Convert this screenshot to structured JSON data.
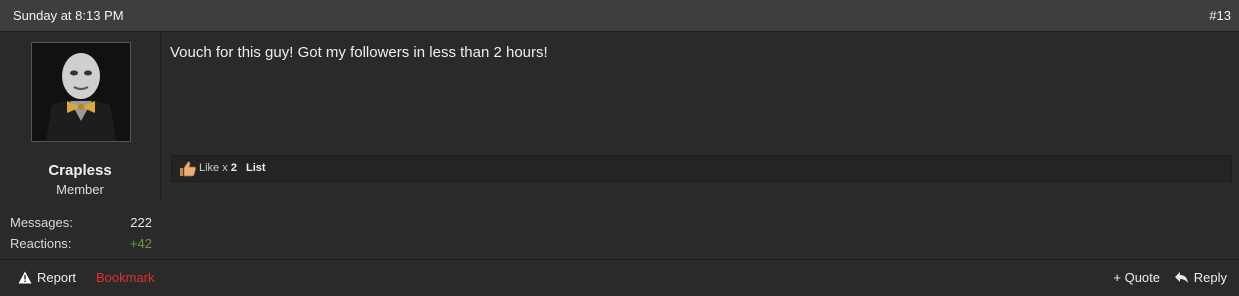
{
  "post": {
    "date": "Sunday at 8:13 PM",
    "number": "#13",
    "message": "Vouch for this guy! Got my followers in less than 2 hours!"
  },
  "user": {
    "name": "Crapless",
    "title": "Member",
    "avatar_icon": "user-avatar-photo",
    "stats": [
      {
        "label": "Messages:",
        "value": "222"
      },
      {
        "label": "Reactions:",
        "value": "+42"
      }
    ]
  },
  "likes": {
    "prefix": "Like x",
    "count": "2",
    "list_label": "List",
    "icon": "thumbs-up-icon"
  },
  "footer": {
    "report_label": "Report",
    "bookmark_label": "Bookmark",
    "quote_label": "+ Quote",
    "reply_label": "Reply"
  },
  "colors": {
    "header_bg": "#3e3e3e",
    "body_bg": "#2a2a2a",
    "positive": "#6c9a3a",
    "bookmark": "#e03030"
  }
}
